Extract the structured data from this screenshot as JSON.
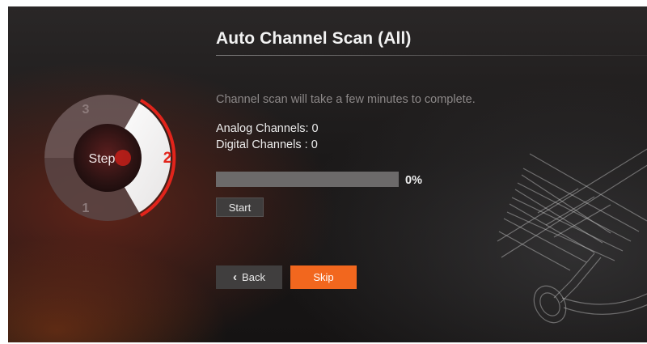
{
  "header": {
    "title": "Auto Channel Scan (All)"
  },
  "step_wheel": {
    "center_label": "Step",
    "steps": [
      "1",
      "2",
      "3"
    ],
    "current_step": "2",
    "accent": "#e2241b"
  },
  "info": {
    "message": "Channel scan will take a few minutes to complete."
  },
  "channels": {
    "analog_label": "Analog Channels:",
    "analog_value": "0",
    "digital_label": "Digital Channels :",
    "digital_value": "0"
  },
  "progress": {
    "percent": 0,
    "text": "0%"
  },
  "buttons": {
    "start": "Start",
    "back": "Back",
    "skip": "Skip"
  },
  "icons": {
    "back": "chevron-left-icon",
    "antenna": "antenna-illustration"
  },
  "colors": {
    "accent_orange": "#f2671e",
    "accent_red": "#e2241b"
  }
}
